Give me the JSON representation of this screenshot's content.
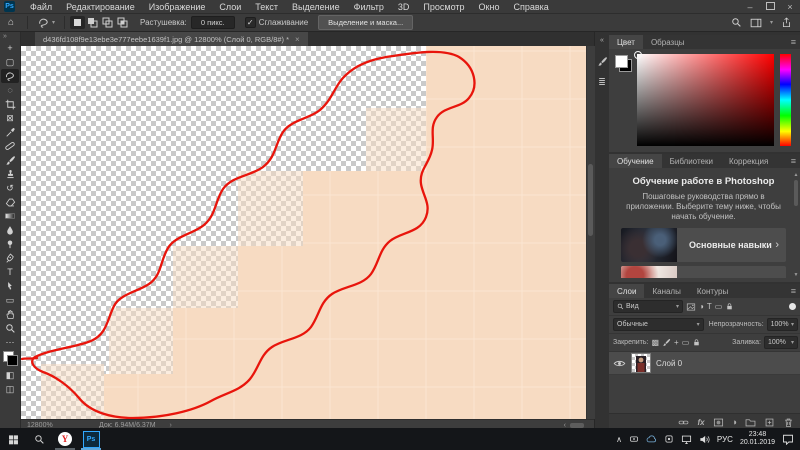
{
  "menubar": {
    "logo": "Ps",
    "items": [
      "Файл",
      "Редактирование",
      "Изображение",
      "Слои",
      "Текст",
      "Выделение",
      "Фильтр",
      "3D",
      "Просмотр",
      "Окно",
      "Справка"
    ]
  },
  "window": {
    "minimize": "–",
    "close": "×"
  },
  "optionsbar": {
    "feather_label": "Растушевка:",
    "feather_value": "0 пикс.",
    "antialias_label": "Сглаживание",
    "select_and_mask": "Выделение и маска..."
  },
  "document": {
    "tab_title": "d436fd108f9e13ebe3e777eebe1639f1.jpg @ 12800% (Слой 0, RGB/8#) *",
    "zoom": "12800%",
    "doc_info": "Док: 6.94М/6.37М"
  },
  "canvas": {
    "peach": "#f7dbc2",
    "red": "#e8150c",
    "grid": "#fbe8d6"
  },
  "panels": {
    "color": {
      "tabs": [
        "Цвет",
        "Образцы"
      ]
    },
    "learn": {
      "tabs": [
        "Обучение",
        "Библиотеки",
        "Коррекция"
      ],
      "title": "Обучение работе в Photoshop",
      "body": "Пошаговые руководства прямо в приложении. Выберите тему ниже, чтобы начать обучение.",
      "card": "Основные навыки"
    },
    "layers": {
      "tabs": [
        "Слои",
        "Каналы",
        "Контуры"
      ],
      "filter_value": "Вид",
      "blend_mode": "Обычные",
      "opacity_label": "Непрозрачность:",
      "opacity_value": "100%",
      "lock_label": "Закрепить:",
      "fill_label": "Заливка:",
      "fill_value": "100%",
      "layer_name": "Слой 0",
      "fx_label": "fx"
    }
  },
  "taskbar": {
    "yandex_letter": "Y",
    "ps_label": "Ps",
    "lang": "РУС",
    "time": "23:48",
    "date": "20.01.2019"
  },
  "icons": {
    "dropdown": "▾",
    "menu": "≡",
    "ellipsis": "⋯",
    "chev_right": "›",
    "chev_left": "‹",
    "up": "▲",
    "down": "▼",
    "collapse": "«",
    "expand": "»",
    "home": "⌂",
    "check": "✓",
    "tray_up": "∧",
    "move": "+",
    "marquee": "▢",
    "wand": "◌",
    "frame": "⊠",
    "history": "↺",
    "rect_shape": "▭",
    "type": "T",
    "quickmask": "◧",
    "screenmode": "◫",
    "adjust": "◑",
    "checker": "▩",
    "lines": "≣"
  }
}
